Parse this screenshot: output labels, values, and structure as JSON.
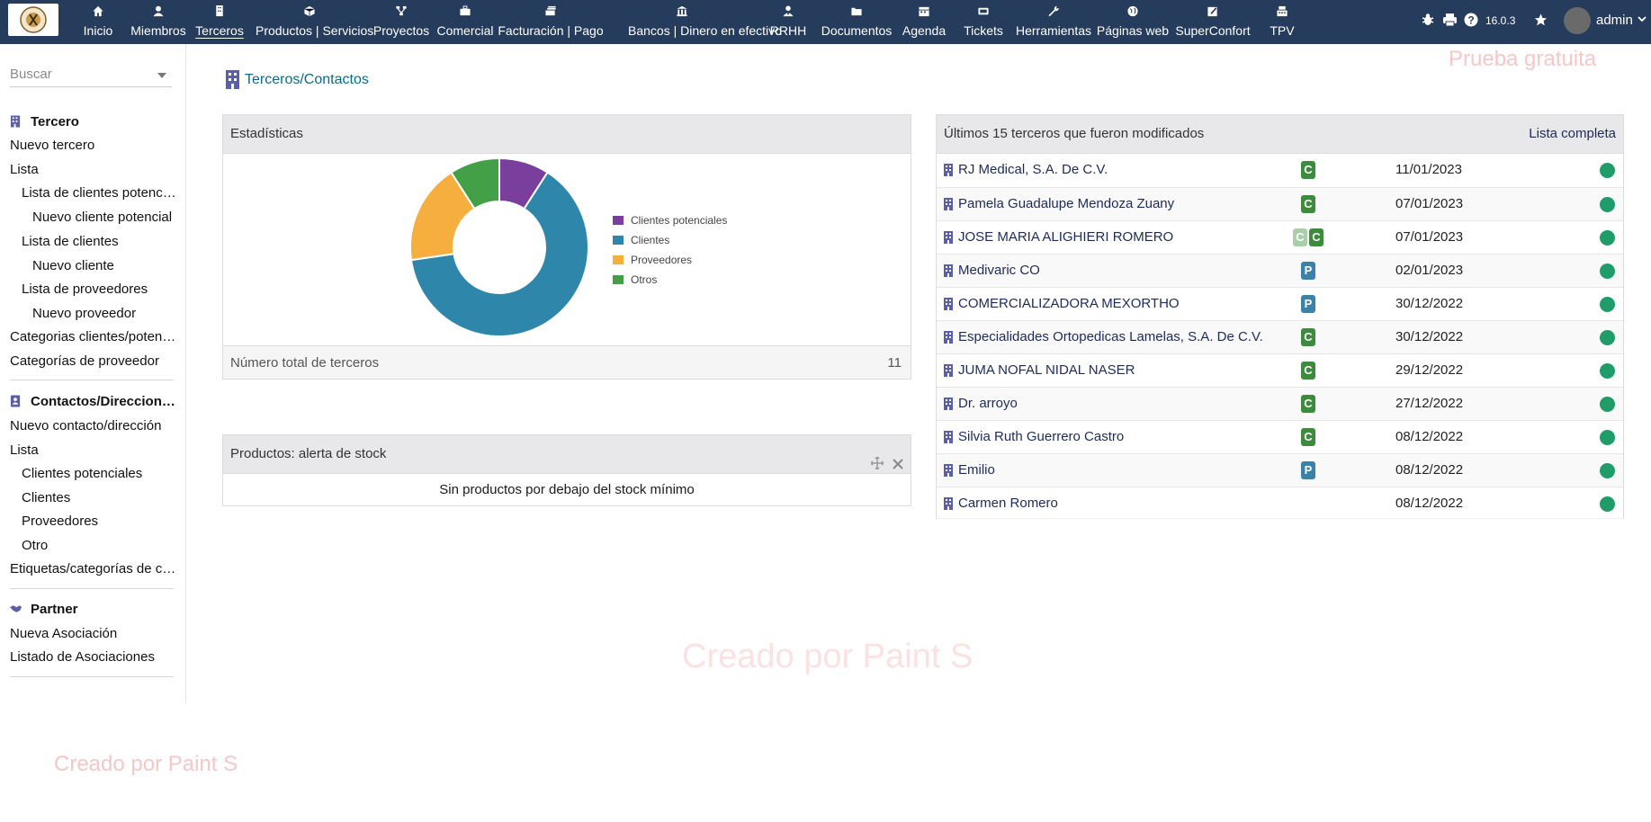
{
  "topnav": {
    "items": [
      {
        "label": "Inicio",
        "icon": "home-icon"
      },
      {
        "label": "Miembros",
        "icon": "user-icon"
      },
      {
        "label": "Terceros",
        "icon": "building-icon"
      },
      {
        "label": "Productos | Servicios",
        "icon": "cube-icon"
      },
      {
        "label": "Proyectos",
        "icon": "sitemap-icon"
      },
      {
        "label": "Comercial",
        "icon": "suitcase-icon"
      },
      {
        "label": "Facturación | Pago",
        "icon": "money-icon"
      },
      {
        "label": "Bancos | Dinero en efectivo",
        "icon": "bank-icon"
      },
      {
        "label": "RRHH",
        "icon": "user-tie-icon"
      },
      {
        "label": "Documentos",
        "icon": "folder-icon"
      },
      {
        "label": "Agenda",
        "icon": "calendar-icon"
      },
      {
        "label": "Tickets",
        "icon": "ticket-icon"
      },
      {
        "label": "Herramientas",
        "icon": "wrench-icon"
      },
      {
        "label": "Páginas web",
        "icon": "globe-icon"
      },
      {
        "label": "SuperConfort",
        "icon": "edit-icon"
      },
      {
        "label": "TPV",
        "icon": "cash-register-icon"
      }
    ],
    "active": "Terceros",
    "version": "16.0.3",
    "user": "admin"
  },
  "sidebar": {
    "search_placeholder": "Buscar",
    "sections": [
      {
        "title": "Tercero",
        "links": [
          "Nuevo tercero",
          "Lista",
          "Lista de clientes potenc…",
          "Nuevo cliente potencial",
          "Lista de clientes",
          "Nuevo cliente",
          "Lista de proveedores",
          "Nuevo proveedor",
          "Categorias clientes/poten…",
          "Categorías de proveedor"
        ]
      },
      {
        "title": "Contactos/Direccion…",
        "links": [
          "Nuevo contacto/dirección",
          "Lista",
          "Clientes potenciales",
          "Clientes",
          "Proveedores",
          "Otro",
          "Etiquetas/categorías de c…"
        ]
      },
      {
        "title": "Partner",
        "links": [
          "Nueva Asociación",
          "Listado de Asociaciones"
        ]
      }
    ]
  },
  "main": {
    "title": "Terceros/Contactos",
    "stats": {
      "title": "Estadísticas",
      "total_label": "Número total de terceros",
      "total_value": "11"
    },
    "stock": {
      "title": "Productos: alerta de stock",
      "message": "Sin productos por debajo del stock mínimo"
    },
    "recent": {
      "title": "Últimos 15 terceros que fueron modificados",
      "link": "Lista completa",
      "rows": [
        {
          "name": "RJ Medical, S.A. De C.V.",
          "badges": [
            "C"
          ],
          "date": "11/01/2023"
        },
        {
          "name": "Pamela Guadalupe Mendoza Zuany",
          "badges": [
            "C"
          ],
          "date": "07/01/2023"
        },
        {
          "name": "JOSE MARIA ALIGHIERI ROMERO",
          "badges": [
            "C",
            "C"
          ],
          "date": "07/01/2023"
        },
        {
          "name": "Medivaric CO",
          "badges": [
            "P"
          ],
          "date": "02/01/2023"
        },
        {
          "name": "COMERCIALIZADORA MEXORTHO",
          "badges": [
            "P"
          ],
          "date": "30/12/2022"
        },
        {
          "name": "Especialidades Ortopedicas Lamelas, S.A. De C.V.",
          "badges": [
            "C"
          ],
          "date": "30/12/2022"
        },
        {
          "name": "JUMA NOFAL NIDAL NASER",
          "badges": [
            "C"
          ],
          "date": "29/12/2022"
        },
        {
          "name": "Dr. arroyo",
          "badges": [
            "C"
          ],
          "date": "27/12/2022"
        },
        {
          "name": "Silvia Ruth Guerrero Castro",
          "badges": [
            "C"
          ],
          "date": "08/12/2022"
        },
        {
          "name": "Emilio",
          "badges": [
            "P"
          ],
          "date": "08/12/2022"
        },
        {
          "name": "Carmen Romero",
          "badges": [],
          "date": "08/12/2022"
        }
      ]
    }
  },
  "chart_data": {
    "type": "pie",
    "categories": [
      "Clientes potenciales",
      "Clientes",
      "Proveedores",
      "Otros"
    ],
    "values": [
      1,
      7,
      2,
      1
    ],
    "colors": [
      "#7A3E9D",
      "#2E86AB",
      "#F6AE3E",
      "#43A047"
    ]
  },
  "watermarks": {
    "trial": "Prueba gratuita",
    "created": "Creado por Paint S"
  },
  "colors": {
    "topbar": "#263C5C",
    "link": "#1d2b5a",
    "status_active": "#1f9c6a",
    "badge_c": "#3d8b3d",
    "badge_p": "#3a82a8"
  }
}
